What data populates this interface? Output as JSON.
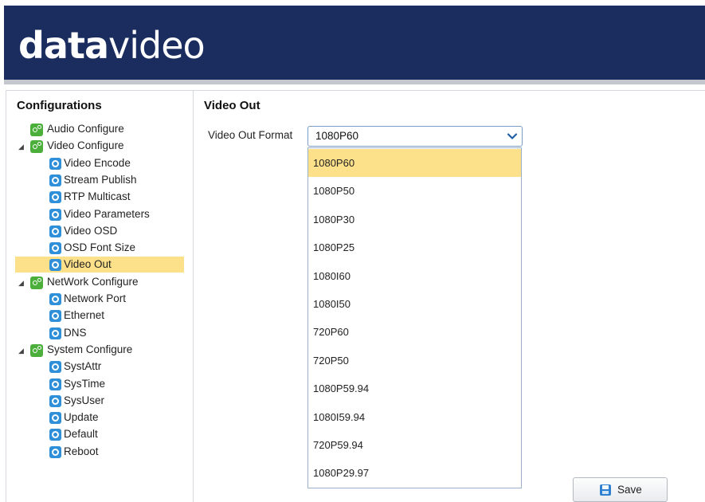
{
  "brand": {
    "logo_bold": "data",
    "logo_light": "video",
    "header_color": "#1b2d5e"
  },
  "sidebar": {
    "title": "Configurations",
    "groups": [
      {
        "label": "Audio Configure",
        "expanded": null,
        "items": []
      },
      {
        "label": "Video Configure",
        "expanded": true,
        "items": [
          {
            "label": "Video Encode"
          },
          {
            "label": "Stream Publish"
          },
          {
            "label": "RTP Multicast"
          },
          {
            "label": "Video Parameters"
          },
          {
            "label": "Video OSD"
          },
          {
            "label": "OSD Font Size"
          },
          {
            "label": "Video Out",
            "selected": true
          }
        ]
      },
      {
        "label": "NetWork Configure",
        "expanded": true,
        "items": [
          {
            "label": "Network Port"
          },
          {
            "label": "Ethernet"
          },
          {
            "label": "DNS"
          }
        ]
      },
      {
        "label": "System Configure",
        "expanded": true,
        "items": [
          {
            "label": "SystAttr"
          },
          {
            "label": "SysTime"
          },
          {
            "label": "SysUser"
          },
          {
            "label": "Update"
          },
          {
            "label": "Default"
          },
          {
            "label": "Reboot"
          }
        ]
      }
    ],
    "icons": {
      "group": "gears-icon",
      "item": "gear-icon",
      "expanded": "triangle-expanded-icon"
    }
  },
  "main": {
    "title": "Video Out",
    "field_label": "Video Out Format",
    "selected_value": "1080P60",
    "options": [
      "1080P60",
      "1080P50",
      "1080P30",
      "1080P25",
      "1080I60",
      "1080I50",
      "720P60",
      "720P50",
      "1080P59.94",
      "1080I59.94",
      "720P59.94",
      "1080P29.97"
    ],
    "highlighted_option": "1080P60",
    "save_label": "Save"
  },
  "colors": {
    "highlight": "#fde08a",
    "accent": "#2f8fd8",
    "group_icon": "#4caf3c"
  }
}
